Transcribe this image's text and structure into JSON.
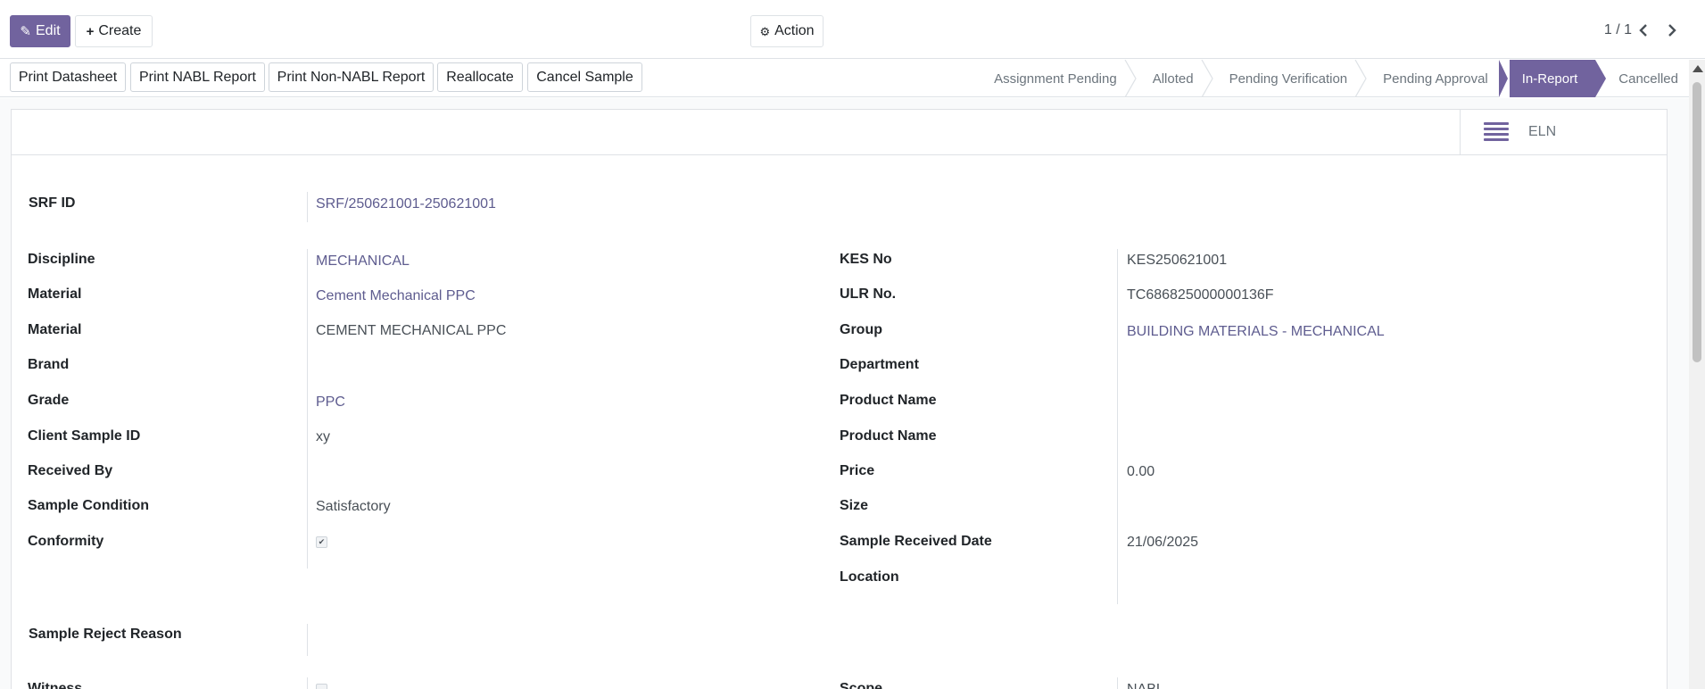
{
  "toolbar": {
    "edit_label": "Edit",
    "create_label": "Create",
    "action_label": "Action",
    "pager": "1 / 1",
    "prev_icon": "chevron-left-icon",
    "next_icon": "chevron-right-icon"
  },
  "header_buttons": [
    "Print Datasheet",
    "Print NABL Report",
    "Print Non-NABL Report",
    "Reallocate",
    "Cancel Sample"
  ],
  "stages": [
    {
      "label": "Assignment Pending",
      "active": false
    },
    {
      "label": "Alloted",
      "active": false
    },
    {
      "label": "Pending Verification",
      "active": false
    },
    {
      "label": "Pending Approval",
      "active": false
    },
    {
      "label": "In-Report",
      "active": true
    },
    {
      "label": "Cancelled",
      "active": false
    }
  ],
  "button_box": {
    "eln_label": "ELN",
    "eln_icon": "list-icon"
  },
  "form": {
    "srf_id": {
      "label": "SRF ID",
      "value": "SRF/250621001-250621001"
    },
    "left": [
      {
        "label": "Discipline",
        "value": "MECHANICAL",
        "link": true
      },
      {
        "label": "Material",
        "value": "Cement Mechanical PPC",
        "link": true
      },
      {
        "label": "Material",
        "value": "CEMENT MECHANICAL PPC",
        "link": false
      },
      {
        "label": "Brand",
        "value": "",
        "link": false
      },
      {
        "label": "Grade",
        "value": "PPC",
        "link": true
      },
      {
        "label": "Client Sample ID",
        "value": "xy",
        "link": false
      },
      {
        "label": "Received By",
        "value": "",
        "link": false
      },
      {
        "label": "Sample Condition",
        "value": "Satisfactory",
        "link": false
      },
      {
        "label": "Conformity",
        "value": "",
        "checkbox": true,
        "checked": true
      }
    ],
    "right": [
      {
        "label": "KES No",
        "value": "KES250621001",
        "link": false
      },
      {
        "label": "ULR No.",
        "value": "TC686825000000136F",
        "link": false
      },
      {
        "label": "Group",
        "value": "BUILDING MATERIALS - MECHANICAL",
        "link": true
      },
      {
        "label": "Department",
        "value": "",
        "link": false
      },
      {
        "label": "Product Name",
        "value": "",
        "link": false
      },
      {
        "label": "Product Name",
        "value": "",
        "link": false
      },
      {
        "label": "Price",
        "value": "0.00",
        "link": false
      },
      {
        "label": "Size",
        "value": "",
        "link": false
      },
      {
        "label": "Sample Received Date",
        "value": "21/06/2025",
        "link": false
      },
      {
        "label": "Location",
        "value": "",
        "link": false
      }
    ],
    "reject": {
      "label": "Sample Reject Reason",
      "value": ""
    },
    "bottom_left": {
      "label": "Witness",
      "value": ""
    },
    "bottom_right": {
      "label": "Scope",
      "value": "NABL"
    }
  },
  "colors": {
    "primary": "#71639e",
    "link": "#5e5c8f"
  }
}
